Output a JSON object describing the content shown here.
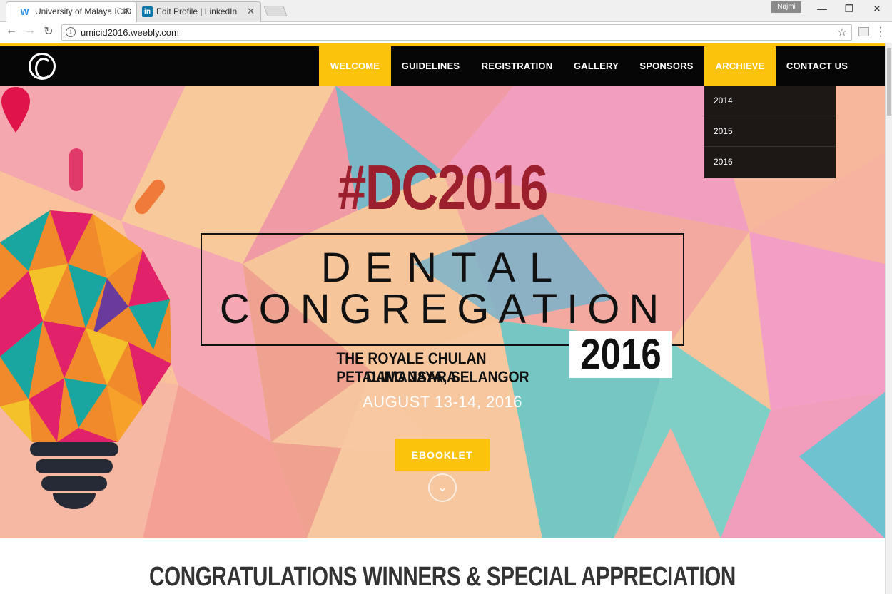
{
  "browser": {
    "tabs": [
      {
        "title": "University of Malaya ICID",
        "icon": "weebly-icon",
        "active": true
      },
      {
        "title": "Edit Profile | LinkedIn",
        "icon": "linkedin-icon",
        "active": false
      }
    ],
    "user": "Najmi",
    "url": "umicid2016.weebly.com"
  },
  "header": {
    "nav": [
      {
        "label": "WELCOME",
        "highlighted": true
      },
      {
        "label": "GUIDELINES",
        "highlighted": false
      },
      {
        "label": "REGISTRATION",
        "highlighted": false
      },
      {
        "label": "GALLERY",
        "highlighted": false
      },
      {
        "label": "SPONSORS",
        "highlighted": false
      },
      {
        "label": "ARCHIEVE",
        "highlighted": true
      },
      {
        "label": "CONTACT US",
        "highlighted": false
      }
    ],
    "archive_dropdown": [
      "2014",
      "2015",
      "2016"
    ]
  },
  "hero": {
    "hashtag": "#DC2016",
    "title_line1": "DENTAL",
    "title_line2": "CONGREGATION",
    "year": "2016",
    "venue_line1": "THE ROYALE CHULAN DAMANSARA",
    "venue_line2": "PETALING JAYA, SELANGOR",
    "date": "AUGUST 13-14, 2016",
    "button": "EBOOKLET"
  },
  "section": {
    "title": "CONGRATULATIONS WINNERS & SPECIAL APPRECIATION"
  },
  "colors": {
    "accent": "#fcc30d",
    "nav_bg": "#060606",
    "hashtag": "#9b1f2c"
  }
}
